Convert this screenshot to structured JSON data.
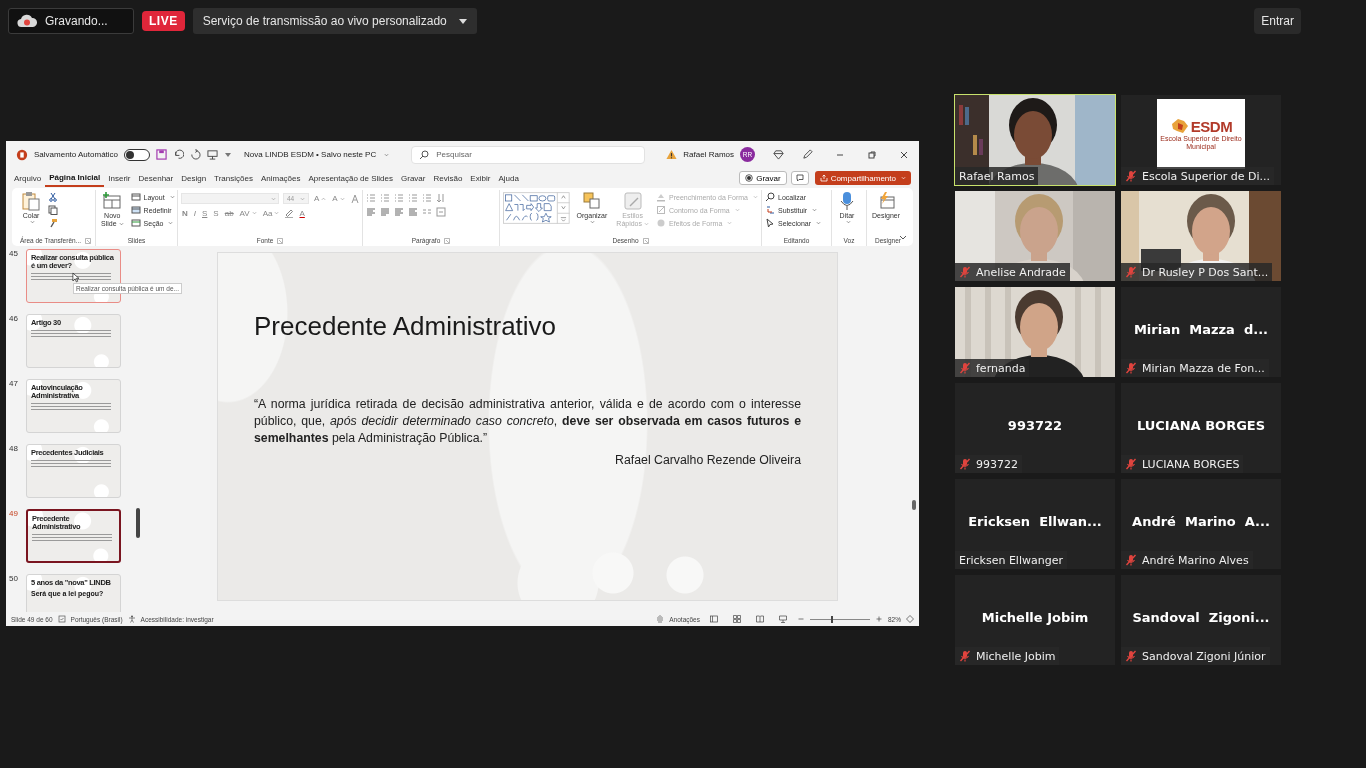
{
  "top_bar": {
    "recording": "Gravando...",
    "live_badge": "LIVE",
    "stream_menu": "Serviço de transmissão ao vivo personalizado",
    "join_button": "Entrar"
  },
  "presentation_window": {
    "title_bar": {
      "autosave_label": "Salvamento Automático",
      "autosave_on": false,
      "document": "Nova LINDB ESDM • Salvo neste PC",
      "search": {
        "placeholder": "Pesquisar"
      },
      "user": "Rafael Ramos",
      "avatar": "RR"
    },
    "menu_tabs": [
      {
        "label": "Arquivo",
        "selected": false
      },
      {
        "label": "Página Inicial",
        "selected": true
      },
      {
        "label": "Inserir",
        "selected": false
      },
      {
        "label": "Desenhar",
        "selected": false
      },
      {
        "label": "Design",
        "selected": false
      },
      {
        "label": "Transições",
        "selected": false
      },
      {
        "label": "Animações",
        "selected": false
      },
      {
        "label": "Apresentação de Slides",
        "selected": false
      },
      {
        "label": "Gravar",
        "selected": false
      },
      {
        "label": "Revisão",
        "selected": false
      },
      {
        "label": "Exibir",
        "selected": false
      },
      {
        "label": "Ajuda",
        "selected": false
      }
    ],
    "record_button": "Gravar",
    "share_button": "Compartilhamento",
    "ribbon": {
      "clipboard": {
        "label": "Área de Transferên...",
        "paste": "Colar"
      },
      "slides": {
        "label": "Slides",
        "new_slide": "Novo",
        "new_slide_2": "Slide",
        "commands": [
          "Layout",
          "Redefinir",
          "Seção"
        ]
      },
      "font": {
        "label": "Fonte",
        "size": "44",
        "grow": "A",
        "shrink": "A",
        "styles": [
          "N",
          "I",
          "S",
          "S",
          "ab"
        ],
        "spacing": "AV",
        "case": "Aa",
        "color_letter": "A"
      },
      "paragraph": {
        "label": "Parágrafo"
      },
      "drawing": {
        "label": "Desenho",
        "arrange": "Organizar",
        "quick_styles": "Estilos",
        "quick_styles_2": "Rápidos",
        "quick_styles_disabled": true,
        "shape_commands": [
          {
            "label": "Preenchimento da Forma",
            "disabled": true
          },
          {
            "label": "Contorno da Forma",
            "disabled": true
          },
          {
            "label": "Efeitos de Forma",
            "disabled": true
          }
        ]
      },
      "editing": {
        "label": "Editando",
        "commands": [
          "Localizar",
          "Substituir",
          "Selecionar"
        ]
      },
      "voice": {
        "label": "Voz",
        "dictate": "Ditar"
      },
      "designer": {
        "label": "Designer",
        "button": "Designer"
      }
    },
    "thumbnails": [
      {
        "number": "45",
        "title": "Realizar consulta pública é um dever?",
        "selected": false,
        "hovered": true
      },
      {
        "number": "46",
        "title": "Artigo 30",
        "selected": false,
        "hovered": false
      },
      {
        "number": "47",
        "title": "Autovinculação Administrativa",
        "selected": false,
        "hovered": false
      },
      {
        "number": "48",
        "title": "Precedentes Judiciais",
        "selected": false,
        "hovered": false
      },
      {
        "number": "49",
        "title": "Precedente Administrativo",
        "selected": true,
        "hovered": false
      },
      {
        "number": "50",
        "title": "5 anos da \"nova\" LINDB",
        "heading": "Será que a lei pegou?",
        "selected": false,
        "hovered": false
      }
    ],
    "tooltip": "Realizar consulta pública é um de...",
    "slide": {
      "title": "Precedente Administrativo",
      "quote": "“A norma jurídica retirada de decisão administrativa anterior, válida e de acordo com o interesse público, que, *após decidir determinado caso concreto*, **deve ser observada em casos futuros e semelhantes** pela Administração Pública.”",
      "author": "Rafael Carvalho Rezende Oliveira"
    },
    "status_bar": {
      "slide_count": "Slide 49 de 60",
      "language": "Português (Brasil)",
      "accessibility": "Acessibilidade: investigar",
      "notes": "Anotações",
      "zoom": "82%",
      "zoom_slider": {
        "level": 0.35
      }
    }
  },
  "participants": [
    {
      "kind": "video",
      "name": "Rafael Ramos",
      "muted": false,
      "speaking": true
    },
    {
      "kind": "logo",
      "name": "Escola Superior de Di...",
      "logo": "ESDM",
      "logo_caption": "Escola Superior de Direito Municipal",
      "muted": true,
      "speaking": false
    },
    {
      "kind": "video",
      "name": "Anelise Andrade",
      "muted": true,
      "speaking": false
    },
    {
      "kind": "video",
      "name": "Dr Rusley P Dos Sant...",
      "muted": true,
      "speaking": false
    },
    {
      "kind": "video",
      "name": "fernanda",
      "muted": true,
      "speaking": false
    },
    {
      "kind": "name",
      "display": "Mirian  Mazza  d...",
      "name": "Mirian Mazza de Fon...",
      "muted": true,
      "speaking": false
    },
    {
      "kind": "name",
      "display": "993722",
      "name": "993722",
      "muted": true,
      "speaking": false
    },
    {
      "kind": "name",
      "display": "LUCIANA BORGES",
      "name": "LUCIANA BORGES",
      "muted": true,
      "speaking": false
    },
    {
      "kind": "name",
      "display": "Ericksen  Ellwan...",
      "name": "Ericksen Ellwanger",
      "muted": false,
      "speaking": false
    },
    {
      "kind": "name",
      "display": "André  Marino  A...",
      "name": "André Marino Alves",
      "muted": true,
      "speaking": false
    },
    {
      "kind": "name",
      "display": "Michelle Jobim",
      "name": "Michelle Jobim",
      "muted": true,
      "speaking": false
    },
    {
      "kind": "name",
      "display": "Sandoval  Zigoni...",
      "name": "Sandoval Zigoni Júnior",
      "muted": true,
      "speaking": false
    }
  ]
}
